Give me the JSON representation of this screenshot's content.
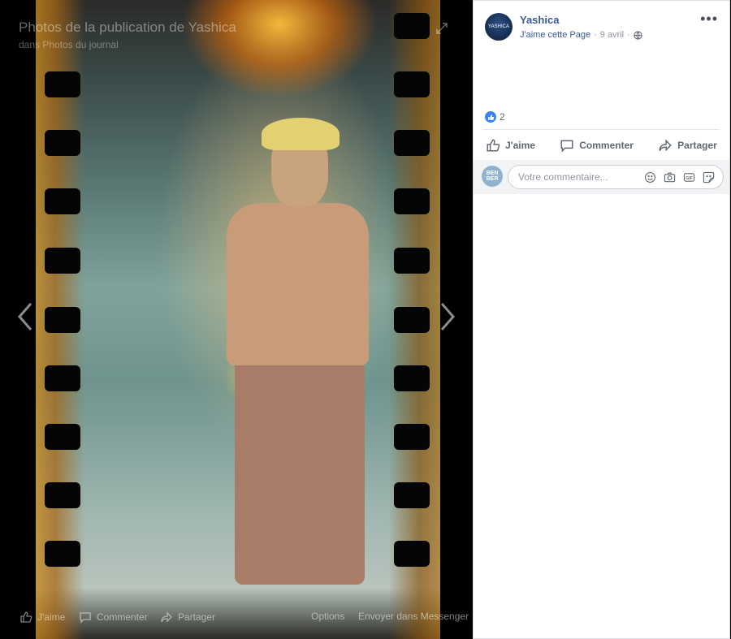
{
  "viewer": {
    "title": "Photos de la publication de Yashica",
    "subtitle": "dans Photos du journal",
    "bottom_actions": {
      "like": "J'aime",
      "comment": "Commenter",
      "share": "Partager",
      "options": "Options",
      "messenger": "Envoyer dans Messenger"
    }
  },
  "post": {
    "page_name": "Yashica",
    "avatar_text": "YASHICA",
    "like_page": "J'aime cette Page",
    "separator": "·",
    "date": "9 avril",
    "reaction_count": "2",
    "actions": {
      "like": "J'aime",
      "comment": "Commenter",
      "share": "Partager"
    },
    "comment_placeholder": "Votre commentaire...",
    "user_avatar_text": "BEN BER"
  }
}
